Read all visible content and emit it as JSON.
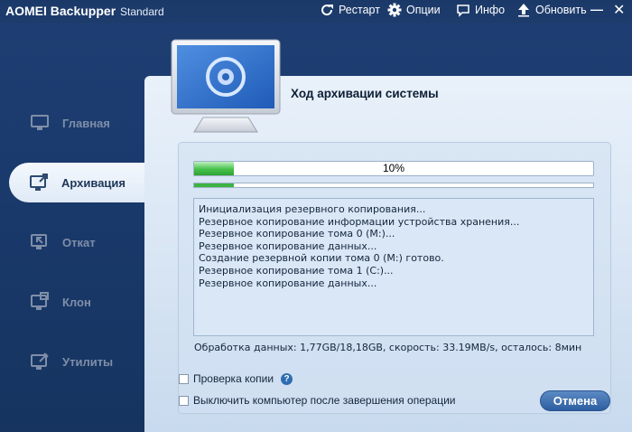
{
  "app": {
    "name": "AOMEI Backupper",
    "edition": "Standard"
  },
  "titlebar": {
    "restart_label": "Рестарт",
    "options_label": "Опции",
    "info_label": "Инфо",
    "update_label": "Обновить",
    "minimize_glyph": "—",
    "close_glyph": "✕"
  },
  "sidebar": {
    "items": [
      {
        "label": "Главная",
        "icon": "home-monitor-icon",
        "active": false
      },
      {
        "label": "Архивация",
        "icon": "backup-icon",
        "active": true
      },
      {
        "label": "Откат",
        "icon": "restore-icon",
        "active": false
      },
      {
        "label": "Клон",
        "icon": "clone-icon",
        "active": false
      },
      {
        "label": "Утилиты",
        "icon": "utilities-icon",
        "active": false
      }
    ]
  },
  "main": {
    "heading": "Ход архивации системы",
    "progress": {
      "percent_label": "10%",
      "fraction": 0.1,
      "sub_fraction": 0.1
    },
    "log_lines": [
      "Инициализация резервного копирования...",
      "Резервное копирование информации устройства хранения...",
      "Резервное копирование тома 0 (M:)...",
      "Резервное копирование данных...",
      "Создание резервной копии тома 0 (M:) готово.",
      "Резервное копирование тома 1 (C:)...",
      "Резервное копирование данных..."
    ],
    "status_text": "Обработка данных: 1,77GB/18,18GB, скорость: 33.19MB/s, осталось: 8мин",
    "verify_label": "Проверка копии",
    "verify_help": "?",
    "shutdown_label": "Выключить компьютер после завершения операции",
    "cancel_label": "Отмена"
  },
  "colors": {
    "accent_green": "#46c14a",
    "panel_bg": "#e9f1fa",
    "app_bg": "#1f3f74"
  }
}
